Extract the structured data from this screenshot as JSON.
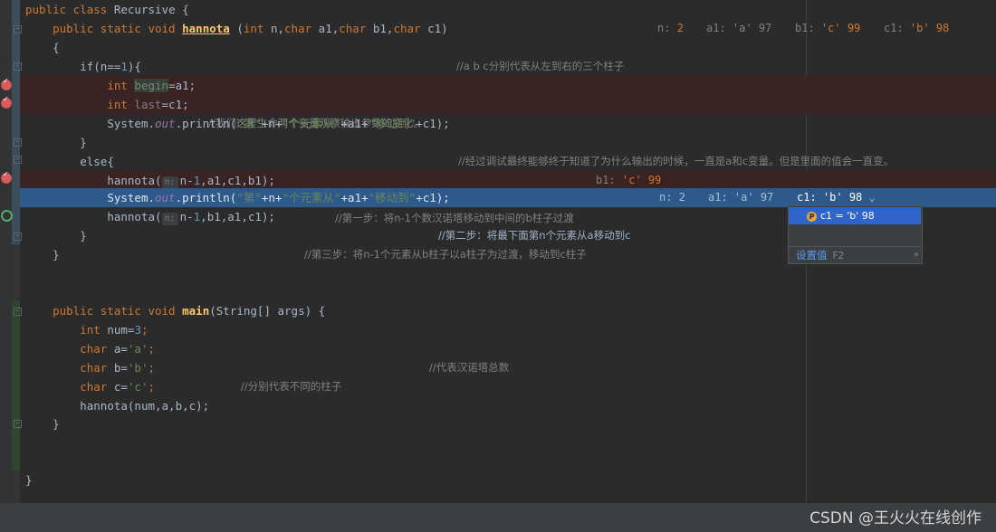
{
  "editor": {
    "l1": {
      "a": "public",
      "b": "class",
      "c": "Recursive {"
    },
    "l2": {
      "a": "public",
      "b": "static",
      "c": "void",
      "fn": "hannota",
      "d": " (",
      "e": "int",
      "f": " n,",
      "g": "char",
      "h": " a1,",
      "i": "char",
      "j": " b1,",
      "k": "char",
      "m": " c1)",
      "cmt": "//a b c分别代表从左到右的三个柱子",
      "vals": [
        {
          "k": "n:",
          "v": "2"
        },
        {
          "k": "a1:",
          "v": "'a' 97"
        },
        {
          "k": "b1:",
          "v": "'c' 99"
        },
        {
          "k": "c1:",
          "v": "'b' 98"
        }
      ]
    },
    "l3": {
      "a": "{"
    },
    "l4": {
      "a": "if(n==",
      "num": "1",
      "b": "){"
    },
    "l5": {
      "kw": "int",
      "var": "begin",
      "rest": "=a1;",
      "cmt": "//我们这里生命两个变量观察输出参数的变化。"
    },
    "l6": {
      "kw": "int",
      "var": "last",
      "rest": "=c1;"
    },
    "l7": {
      "a": "System.",
      "fld": "out",
      "b": ".println(",
      "s1": "\"第\"",
      "c": "+n+",
      "s2": "\"个元素从\"",
      "d": "+a1+",
      "s3": "\"移动到\"",
      "e": "+c1);",
      "cmt": "//经过调试最终能够终于知道了为什么输出的时候，一直是a和c变量。但是里面的值会一直变。"
    },
    "l8": {
      "a": "}"
    },
    "l9": {
      "a": "else{"
    },
    "l10": {
      "fn": "hannota(",
      "hint": "n:",
      "rest": "n-",
      "num": "1",
      "rest2": ",a1,c1,b1);",
      "cmt": "//第一步：将n-1个数汉诺塔移动到中间的b柱子过渡",
      "vk": "b1:",
      "vv": "'c' 99"
    },
    "l11": {
      "a": "System.",
      "fld": "out",
      "b": ".println(",
      "s1": "\"第\"",
      "c": "+n+",
      "s2": "\"个元素从\"",
      "d": "+a1+",
      "s3": "\"移动到\"",
      "e": "+c1);",
      "cmt": "//第二步：将最下面第n个元素从a移动到c",
      "vals": [
        {
          "k": "n:",
          "v": "2"
        },
        {
          "k": "a1:",
          "v": "'a' 97"
        },
        {
          "k": "c1:",
          "v": "'b' 98"
        }
      ]
    },
    "l12": {
      "fn": "hannota(",
      "hint": "n:",
      "rest": "n-",
      "num": "1",
      "rest2": ",b1,a1,c1);",
      "cmt": "//第三步：将n-1个元素从b柱子以a柱子为过渡，移动到c柱子"
    },
    "l13": {
      "a": "}"
    },
    "l14": {
      "a": "}"
    },
    "l15": {
      "a": "public",
      "b": "static",
      "c": "void",
      "fn": "main",
      "d": "(String[] args) {"
    },
    "l16": {
      "kw": "int",
      "a": " num=",
      "num": "3",
      "b": ";",
      "cmt": "//代表汉诺塔总数"
    },
    "l17": {
      "kw": "char",
      "a": " a=",
      "s": "'a'",
      "b": ";",
      "cmt": "//分别代表不同的柱子"
    },
    "l18": {
      "kw": "char",
      "a": " b=",
      "s": "'b'",
      "b": ";"
    },
    "l19": {
      "kw": "char",
      "a": " c=",
      "s": "'c'",
      "b": ";"
    },
    "l20": {
      "a": "hannota(num,a,b,c);"
    },
    "l21": {
      "a": "}"
    },
    "l22": {
      "a": "}"
    }
  },
  "popup": {
    "item_icon": "P",
    "item_label": "c1 = 'b' 98",
    "set_value_label": "设置值",
    "set_value_shortcut": "F2",
    "more": "»"
  },
  "watermark": "CSDN @王火火在线创作",
  "colors": {
    "background": "#2b2b2b",
    "current_line": "#2d5a8a",
    "breakpoint_line": "#3a2323",
    "popup_selection": "#2f65ca"
  }
}
